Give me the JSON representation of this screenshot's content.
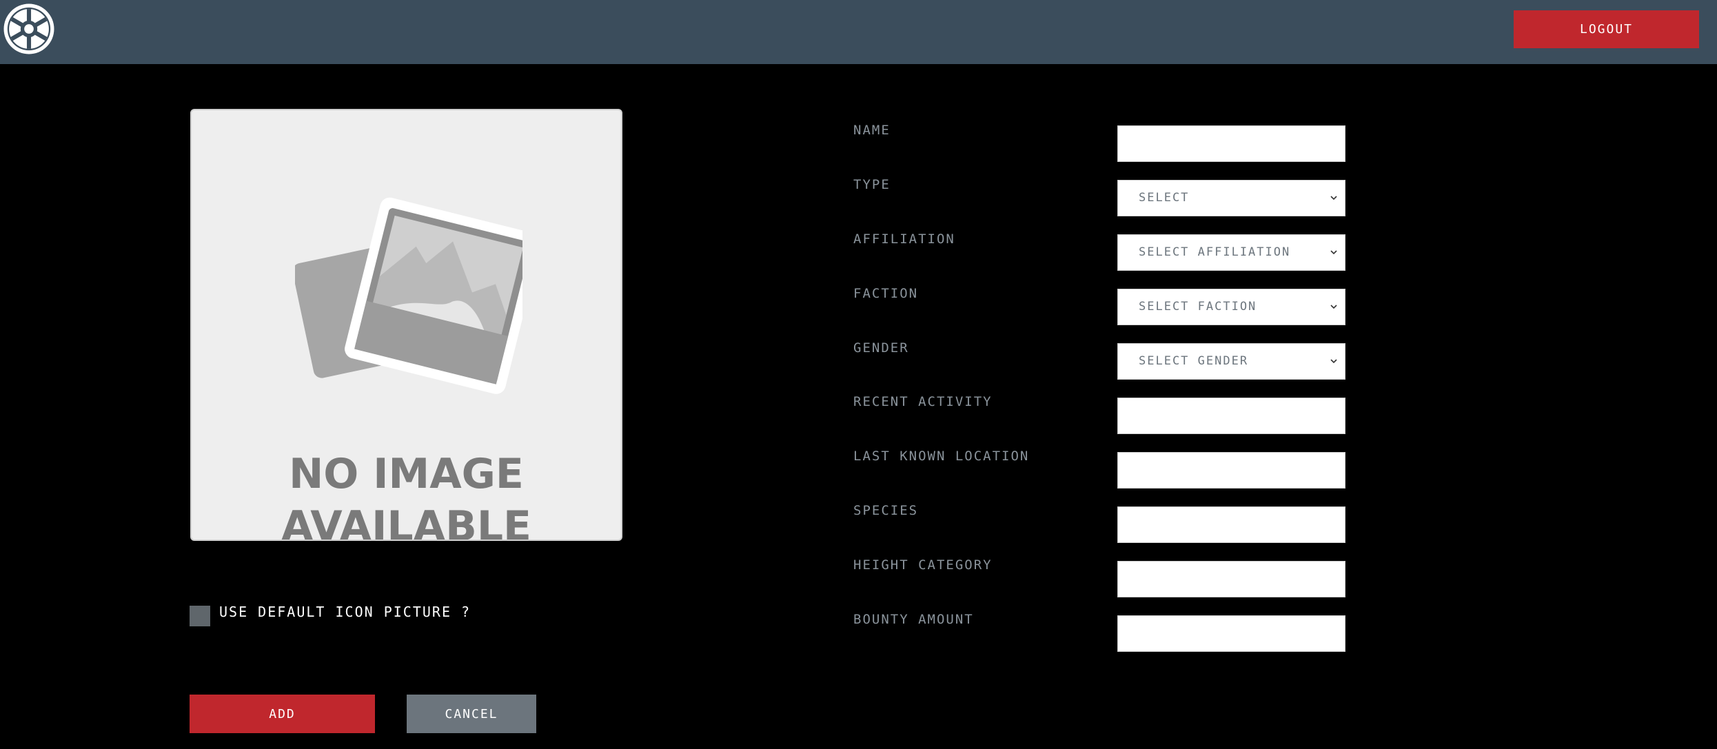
{
  "header": {
    "logo_icon": "imperial-crest-icon",
    "logout_label": "LOGOUT"
  },
  "image_panel": {
    "icon": "photo-placeholder-icon",
    "no_image_line1": "NO IMAGE",
    "no_image_line2": "AVAILABLE"
  },
  "checkbox": {
    "label": "USE DEFAULT ICON PICTURE ?",
    "checked": false
  },
  "actions": {
    "add_label": "ADD",
    "cancel_label": "CANCEL"
  },
  "form": {
    "fields": [
      {
        "label": "NAME",
        "type": "input",
        "value": ""
      },
      {
        "label": "TYPE",
        "type": "select",
        "value": "SELECT"
      },
      {
        "label": "AFFILIATION",
        "type": "select",
        "value": "SELECT AFFILIATION"
      },
      {
        "label": "FACTION",
        "type": "select",
        "value": "SELECT FACTION"
      },
      {
        "label": "GENDER",
        "type": "select",
        "value": "SELECT GENDER"
      },
      {
        "label": "RECENT ACTIVITY",
        "type": "input",
        "value": ""
      },
      {
        "label": "LAST KNOWN LOCATION",
        "type": "input",
        "value": ""
      },
      {
        "label": "SPECIES",
        "type": "input",
        "value": ""
      },
      {
        "label": "HEIGHT CATEGORY",
        "type": "input",
        "value": ""
      },
      {
        "label": "BOUNTY AMOUNT",
        "type": "input",
        "value": ""
      }
    ]
  },
  "colors": {
    "header_bg": "#3b4d5c",
    "primary_red": "#c0272d",
    "secondary_gray": "#6c757d",
    "label_gray": "#8a939b"
  }
}
